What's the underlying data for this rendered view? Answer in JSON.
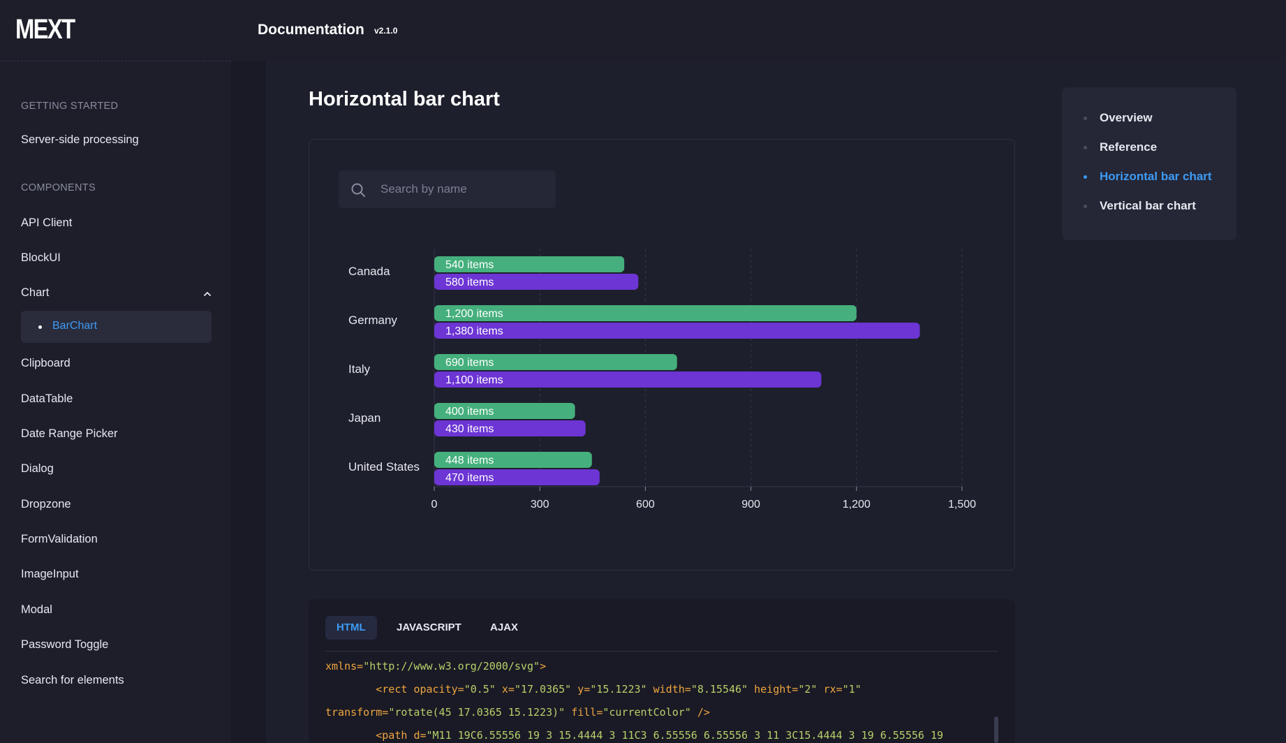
{
  "header": {
    "logo": "MEXT",
    "title": "Documentation",
    "version": "v2.1.0"
  },
  "sidebar": {
    "sections": [
      {
        "heading": "GETTING STARTED",
        "items": [
          "Server-side processing"
        ]
      },
      {
        "heading": "COMPONENTS",
        "items": [
          "API Client",
          "BlockUI",
          "Chart",
          "Clipboard",
          "DataTable",
          "Date Range Picker",
          "Dialog",
          "Dropzone",
          "FormValidation",
          "ImageInput",
          "Modal",
          "Password Toggle",
          "Search for elements"
        ]
      }
    ],
    "active_child": "BarChart"
  },
  "page": {
    "title": "Horizontal bar chart"
  },
  "search": {
    "placeholder": "Search by name"
  },
  "chart_data": {
    "type": "bar",
    "orientation": "horizontal",
    "categories": [
      "Canada",
      "Germany",
      "Italy",
      "Japan",
      "United States"
    ],
    "series": [
      {
        "values": [
          540,
          1200,
          690,
          400,
          448
        ],
        "color": "#45b07d"
      },
      {
        "values": [
          580,
          1380,
          1100,
          430,
          470
        ],
        "color": "#6c35d4"
      }
    ],
    "label_suffix": " items",
    "xlim": [
      0,
      1500
    ],
    "xticks": [
      0,
      300,
      600,
      900,
      1200,
      1500
    ],
    "xtick_labels": [
      "0",
      "300",
      "600",
      "900",
      "1,200",
      "1,500"
    ],
    "grid": true
  },
  "code_tabs": {
    "tabs": [
      "HTML",
      "JAVASCRIPT",
      "AJAX"
    ],
    "active": "HTML"
  },
  "code": {
    "lines": [
      [
        [
          "attr",
          "xmlns="
        ],
        [
          "str",
          "\"http://www.w3.org/2000/svg\""
        ],
        [
          "tagc",
          ">"
        ]
      ],
      [
        [
          "plain",
          "        "
        ],
        [
          "tagc",
          "<rect "
        ],
        [
          "attr",
          "opacity="
        ],
        [
          "str",
          "\"0.5\" "
        ],
        [
          "attr",
          "x="
        ],
        [
          "str",
          "\"17.0365\" "
        ],
        [
          "attr",
          "y="
        ],
        [
          "str",
          "\"15.1223\" "
        ],
        [
          "attr",
          "width="
        ],
        [
          "str",
          "\"8.15546\" "
        ],
        [
          "attr",
          "height="
        ],
        [
          "str",
          "\"2\" "
        ],
        [
          "attr",
          "rx="
        ],
        [
          "str",
          "\"1\""
        ]
      ],
      [
        [
          "attr",
          "transform="
        ],
        [
          "str",
          "\"rotate(45 17.0365 15.1223)\" "
        ],
        [
          "attr",
          "fill="
        ],
        [
          "str",
          "\"currentColor\" "
        ],
        [
          "tagc",
          "/>"
        ]
      ],
      [
        [
          "plain",
          "        "
        ],
        [
          "tagc",
          "<path "
        ],
        [
          "attr",
          "d="
        ],
        [
          "str",
          "\"M11 19C6.55556 19 3 15.4444 3 11C3 6.55556 6.55556 3 11 3C15.4444 3 19 6.55556 19"
        ]
      ]
    ]
  },
  "toc": {
    "items": [
      "Overview",
      "Reference",
      "Horizontal bar chart",
      "Vertical bar chart"
    ],
    "active_index": 2
  },
  "colors": {
    "accent": "#3d9bf5",
    "background": "#1e1f2c",
    "sidebar": "#1d1e2a"
  },
  "icons": {
    "search": "search-icon",
    "collapse": "chevron-up-icon"
  }
}
